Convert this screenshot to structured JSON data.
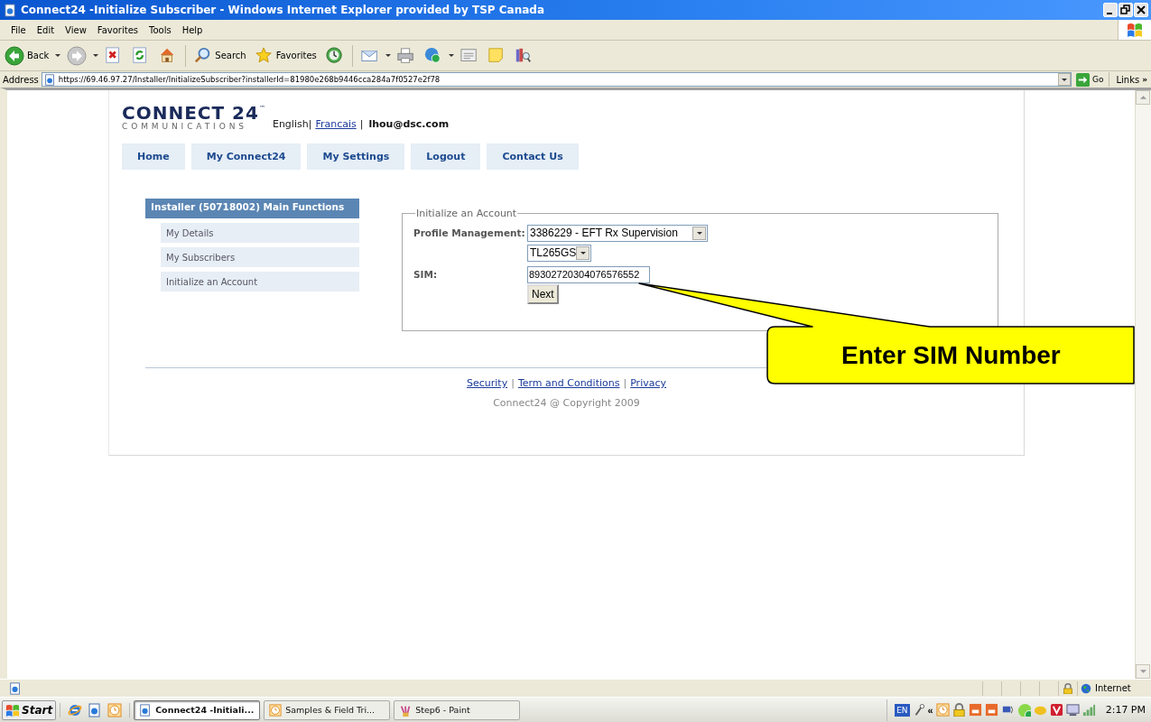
{
  "window": {
    "title": "Connect24 -Initialize Subscriber - Windows Internet Explorer provided by TSP Canada"
  },
  "menu": [
    "File",
    "Edit",
    "View",
    "Favorites",
    "Tools",
    "Help"
  ],
  "toolbar": {
    "back": "Back",
    "search": "Search",
    "favorites": "Favorites"
  },
  "address_bar": {
    "label": "Address",
    "url": "https://69.46.97.27/Installer/InitializeSubscriber?installerId=81980e268b9446cca284a7f0527e2f78",
    "go": "Go",
    "links": "Links",
    "links_more": "»"
  },
  "page": {
    "logo": {
      "name": "CONNECT 24",
      "trademark": "™",
      "tagline": "COMMUNICATIONS"
    },
    "language": {
      "current": "English|",
      "other": "Francais",
      "separator": "|"
    },
    "user": "lhou@dsc.com",
    "nav": [
      "Home",
      "My Connect24",
      "My Settings",
      "Logout",
      "Contact Us"
    ],
    "sidebar": {
      "title": "Installer (50718002) Main Functions",
      "items": [
        "My Details",
        "My Subscribers",
        "Initialize an Account"
      ]
    },
    "form": {
      "legend": "Initialize an Account",
      "profile_label": "Profile Management:",
      "profile_value": "3386229 - EFT Rx Supervision",
      "model_value": "TL265GS",
      "sim_label": "SIM:",
      "sim_value": "89302720304076576552",
      "button": "Next"
    },
    "footer": {
      "links": [
        "Security",
        "Term and Conditions",
        "Privacy"
      ],
      "separators": [
        "|",
        "|"
      ],
      "copyright": "Connect24 @ Copyright 2009"
    }
  },
  "callout": {
    "text": "Enter SIM Number"
  },
  "status_bar": {
    "zone": "Internet"
  },
  "taskbar": {
    "start": "Start",
    "tasks": [
      {
        "label": "Connect24 -Initiali...",
        "selected": true
      },
      {
        "label": "Samples & Field Tri...",
        "selected": false
      },
      {
        "label": "Step6 - Paint",
        "selected": false
      }
    ],
    "language": "EN",
    "tray_expand": "«",
    "clock": "2:17 PM"
  }
}
